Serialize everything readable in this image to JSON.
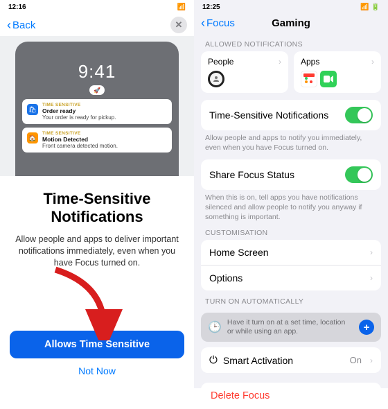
{
  "left": {
    "time": "12:16",
    "back": "Back",
    "preview_time": "9:41",
    "notif1": {
      "tag": "TIME SENSITIVE",
      "title": "Order ready",
      "sub": "Your order is ready for pickup."
    },
    "notif2": {
      "tag": "TIME SENSITIVE",
      "title": "Motion Detected",
      "sub": "Front camera detected motion."
    },
    "heading": "Time-Sensitive Notifications",
    "description": "Allow people and apps to deliver important notifications immediately, even when you have Focus turned on.",
    "primary": "Allows Time Sensitive",
    "secondary": "Not Now"
  },
  "right": {
    "time": "12:25",
    "back": "Focus",
    "title": "Gaming",
    "allowed_label": "ALLOWED NOTIFICATIONS",
    "people": "People",
    "apps": "Apps",
    "ts_row": "Time-Sensitive Notifications",
    "ts_help": "Allow people and apps to notify you immediately, even when you have Focus turned on.",
    "share_row": "Share Focus Status",
    "share_help": "When this is on, tell apps you have notifications silenced and allow people to notify you anyway if something is important.",
    "custom_label": "CUSTOMISATION",
    "home": "Home Screen",
    "options": "Options",
    "auto_label": "TURN ON AUTOMATICALLY",
    "auto_help": "Have it turn on at a set time, location or while using an app.",
    "smart": "Smart Activation",
    "smart_value": "On",
    "delete": "Delete Focus"
  }
}
